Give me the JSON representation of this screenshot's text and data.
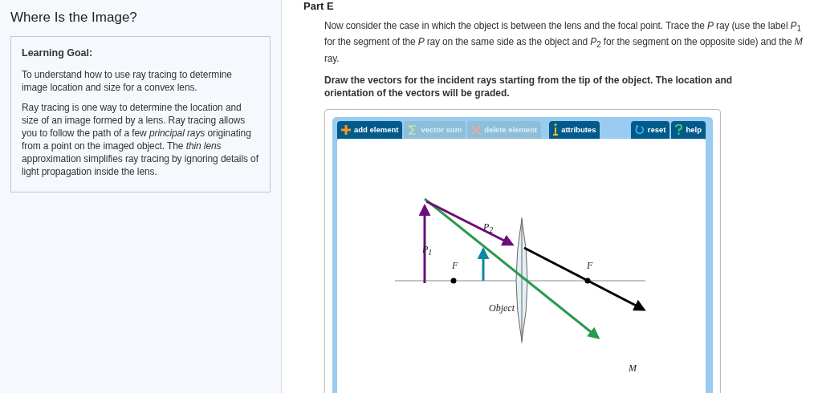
{
  "sidebar": {
    "title": "Where Is the Image?",
    "goal_heading": "Learning Goal:",
    "paragraphs": [
      "To understand how to use ray tracing to determine image location and size for a convex lens.",
      "Ray tracing is one way to determine the location and size of an image formed by a lens. Ray tracing allows you to follow the path of a few *principal rays* originating from a point on the imaged object. The *thin lens* approximation simplifies ray tracing by ignoring details of light propagation inside the lens."
    ]
  },
  "part": {
    "title": "Part E",
    "instructions": "Now consider the case in which the object is between the lens and the focal point. Trace the *P* ray (use the label *P*$_{1}$ for the segment of the *P* ray on the same side as the object and *P*$_{2}$ for the segment on the opposite side) and the *M* ray.",
    "task": "Draw the vectors for the incident rays starting from the tip of the object. The location and orientation of the vectors will be graded."
  },
  "toolbar": [
    {
      "kind": "add",
      "label": "add element",
      "disabled": false
    },
    {
      "kind": "sum",
      "label": "vector sum",
      "disabled": true
    },
    {
      "kind": "delete",
      "label": "delete element",
      "disabled": true
    },
    {
      "kind": "info",
      "label": "attributes",
      "disabled": false
    }
  ],
  "toolbar_right": [
    {
      "kind": "reset",
      "label": "reset",
      "disabled": false
    },
    {
      "kind": "help",
      "label": "help",
      "disabled": false
    }
  ],
  "diagram": {
    "labels": [
      {
        "kind": "p1",
        "text": "*P*$_{1}$"
      },
      {
        "kind": "p2",
        "text": "*P*$_{2}$"
      },
      {
        "kind": "f_left",
        "text": "F"
      },
      {
        "kind": "f_right",
        "text": "F"
      },
      {
        "kind": "object",
        "text": "Object"
      },
      {
        "kind": "m",
        "text": "M"
      }
    ]
  }
}
